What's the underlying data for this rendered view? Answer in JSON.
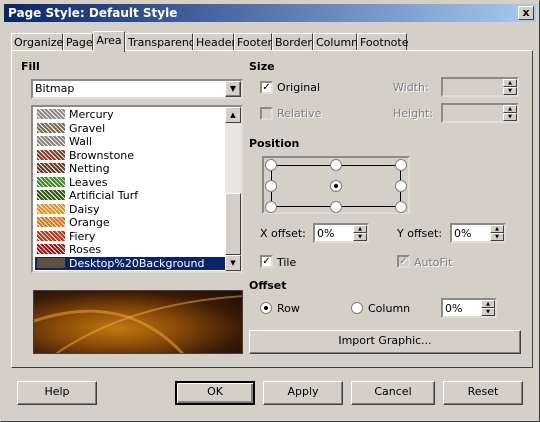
{
  "window": {
    "title": "Page Style: Default Style",
    "close": "x"
  },
  "tabs": [
    "Organizer",
    "Page",
    "Area",
    "Transparency",
    "Header",
    "Footer",
    "Borders",
    "Columns",
    "Footnote"
  ],
  "fill": {
    "heading": "Fill",
    "type_value": "Bitmap",
    "bitmaps": [
      {
        "name": "Mercury",
        "swatch": "#8a8a86"
      },
      {
        "name": "Gravel",
        "swatch": "#7a6a50"
      },
      {
        "name": "Wall",
        "swatch": "#8a8478"
      },
      {
        "name": "Brownstone",
        "swatch": "#8a3a20"
      },
      {
        "name": "Netting",
        "swatch": "#6a3a20"
      },
      {
        "name": "Leaves",
        "swatch": "#3a8a20"
      },
      {
        "name": "Artificial Turf",
        "swatch": "#2a5a10"
      },
      {
        "name": "Daisy",
        "swatch": "#e09020"
      },
      {
        "name": "Orange",
        "swatch": "#e07010"
      },
      {
        "name": "Fiery",
        "swatch": "#c03010"
      },
      {
        "name": "Roses",
        "swatch": "#a01010"
      },
      {
        "name": "Desktop%20Background",
        "swatch": "#6a4a20",
        "selected": true
      }
    ]
  },
  "size": {
    "heading": "Size",
    "original": "Original",
    "relative": "Relative",
    "width_label": "Width:",
    "height_label": "Height:"
  },
  "position": {
    "heading": "Position",
    "x_offset_label": "X offset:",
    "x_offset_value": "0%",
    "y_offset_label": "Y offset:",
    "y_offset_value": "0%",
    "tile": "Tile",
    "autofit": "AutoFit"
  },
  "offset": {
    "heading": "Offset",
    "row": "Row",
    "column": "Column",
    "value": "0%"
  },
  "import_button": "Import Graphic...",
  "buttons": {
    "help": "Help",
    "ok": "OK",
    "apply": "Apply",
    "cancel": "Cancel",
    "reset": "Reset"
  }
}
